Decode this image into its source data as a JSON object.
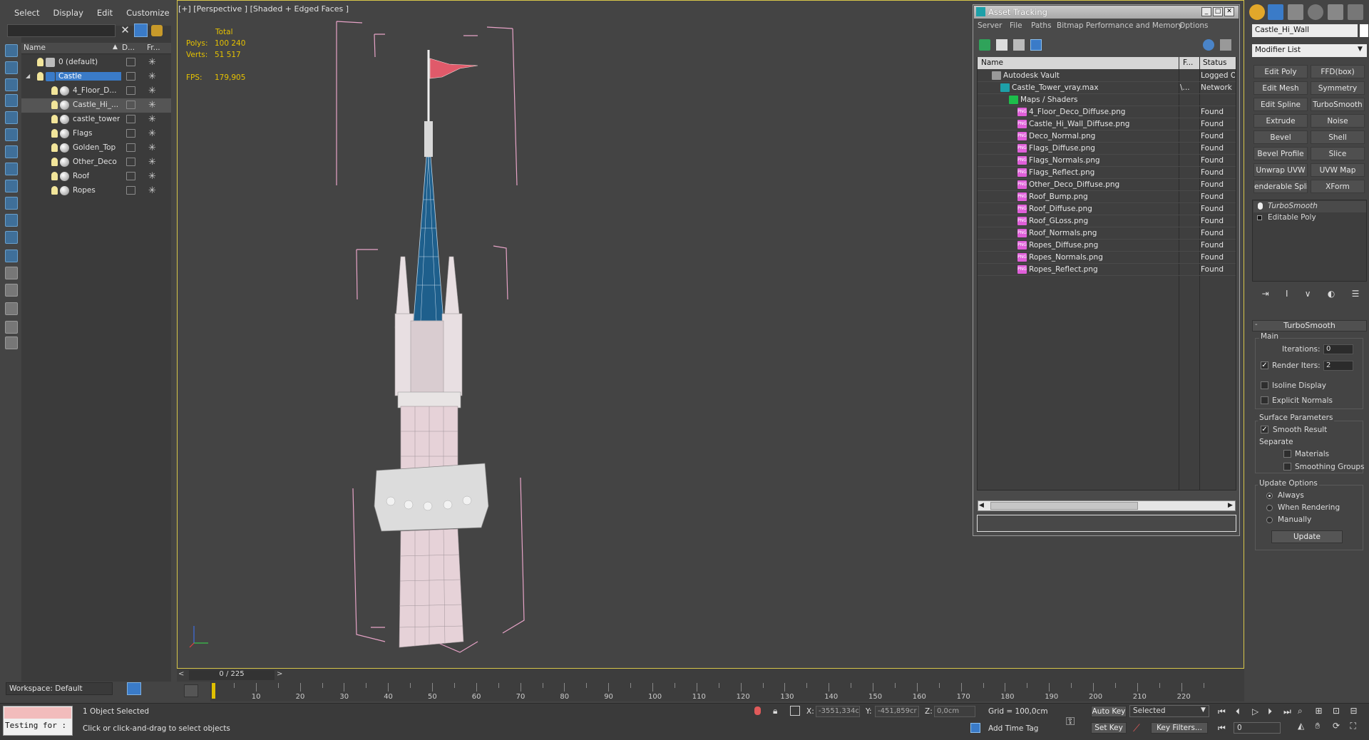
{
  "menu": [
    "Select",
    "Display",
    "Edit",
    "Customize"
  ],
  "scene": {
    "columns": [
      "Name",
      "D...",
      "Fr..."
    ],
    "rows": [
      {
        "name": "0 (default)",
        "indent": 0
      },
      {
        "name": "Castle",
        "indent": 0,
        "selected": true
      },
      {
        "name": "4_Floor_D...",
        "indent": 1
      },
      {
        "name": "Castle_Hi_...",
        "indent": 1
      },
      {
        "name": "castle_tower",
        "indent": 1
      },
      {
        "name": "Flags",
        "indent": 1
      },
      {
        "name": "Golden_Top",
        "indent": 1
      },
      {
        "name": "Other_Deco",
        "indent": 1
      },
      {
        "name": "Roof",
        "indent": 1
      },
      {
        "name": "Ropes",
        "indent": 1
      }
    ],
    "workspace": "Workspace: Default"
  },
  "viewport": {
    "label": "[+] [Perspective ] [Shaded + Edged Faces ]",
    "stats": {
      "total_label": "Total",
      "polys_label": "Polys:",
      "polys_value": "100 240",
      "verts_label": "Verts:",
      "verts_value": "51 517",
      "fps_label": "FPS:",
      "fps_value": "179,905"
    }
  },
  "asset_tracking": {
    "title": "Asset Tracking",
    "menu": [
      "Server",
      "File",
      "Paths",
      "Bitmap Performance and Memory",
      "Options"
    ],
    "columns": [
      "Name",
      "F...",
      "Status"
    ],
    "rows": [
      {
        "name": "Autodesk Vault",
        "f": "",
        "status": "Logged O",
        "type": "vault",
        "indent": 1
      },
      {
        "name": "Castle_Tower_vray.max",
        "f": "\\...",
        "status": "Network P",
        "type": "max",
        "indent": 2
      },
      {
        "name": "Maps / Shaders",
        "f": "",
        "status": "",
        "type": "maps",
        "indent": 3
      },
      {
        "name": "4_Floor_Deco_Diffuse.png",
        "f": "",
        "status": "Found",
        "type": "png",
        "indent": 4
      },
      {
        "name": "Castle_Hi_Wall_Diffuse.png",
        "f": "",
        "status": "Found",
        "type": "png",
        "indent": 4
      },
      {
        "name": "Deco_Normal.png",
        "f": "",
        "status": "Found",
        "type": "png",
        "indent": 4
      },
      {
        "name": "Flags_Diffuse.png",
        "f": "",
        "status": "Found",
        "type": "png",
        "indent": 4
      },
      {
        "name": "Flags_Normals.png",
        "f": "",
        "status": "Found",
        "type": "png",
        "indent": 4
      },
      {
        "name": "Flags_Reflect.png",
        "f": "",
        "status": "Found",
        "type": "png",
        "indent": 4
      },
      {
        "name": "Other_Deco_Diffuse.png",
        "f": "",
        "status": "Found",
        "type": "png",
        "indent": 4
      },
      {
        "name": "Roof_Bump.png",
        "f": "",
        "status": "Found",
        "type": "png",
        "indent": 4
      },
      {
        "name": "Roof_Diffuse.png",
        "f": "",
        "status": "Found",
        "type": "png",
        "indent": 4
      },
      {
        "name": "Roof_GLoss.png",
        "f": "",
        "status": "Found",
        "type": "png",
        "indent": 4
      },
      {
        "name": "Roof_Normals.png",
        "f": "",
        "status": "Found",
        "type": "png",
        "indent": 4
      },
      {
        "name": "Ropes_Diffuse.png",
        "f": "",
        "status": "Found",
        "type": "png",
        "indent": 4
      },
      {
        "name": "Ropes_Normals.png",
        "f": "",
        "status": "Found",
        "type": "png",
        "indent": 4
      },
      {
        "name": "Ropes_Reflect.png",
        "f": "",
        "status": "Found",
        "type": "png",
        "indent": 4
      }
    ]
  },
  "command_panel": {
    "object_name": "Castle_Hi_Wall",
    "modifier_list": "Modifier List",
    "modifier_buttons": [
      "Edit Poly",
      "FFD(box)",
      "Edit Mesh",
      "Symmetry",
      "Edit Spline",
      "TurboSmooth",
      "Extrude",
      "Noise",
      "Bevel",
      "Shell",
      "Bevel Profile",
      "Slice",
      "Unwrap UVW",
      "UVW Map",
      "enderable Splin",
      "XForm"
    ],
    "stack": [
      "TurboSmooth",
      "Editable Poly"
    ],
    "turbosmooth": {
      "title": "TurboSmooth",
      "main": "Main",
      "iterations_label": "Iterations:",
      "iterations": "0",
      "render_iters_label": "Render Iters:",
      "render_iters": "2",
      "isoline": "Isoline Display",
      "explicit_normals": "Explicit Normals",
      "surface_params": "Surface Parameters",
      "smooth_result": "Smooth Result",
      "separate": "Separate",
      "materials": "Materials",
      "smoothing_groups": "Smoothing Groups",
      "update_options": "Update Options",
      "always": "Always",
      "when_rendering": "When Rendering",
      "manually": "Manually",
      "update": "Update"
    }
  },
  "timeline": {
    "frame": "0 / 225",
    "ticks": [
      "10",
      "20",
      "30",
      "40",
      "50",
      "60",
      "70",
      "80",
      "90",
      "100",
      "110",
      "120",
      "130",
      "140",
      "150",
      "160",
      "170",
      "180",
      "190",
      "200",
      "210",
      "220"
    ]
  },
  "status": {
    "maxscript": "Testing for :",
    "selection": "1 Object Selected",
    "prompt": "Click or click-and-drag to select objects",
    "x_label": "X:",
    "x": "-3551,334c",
    "y_label": "Y:",
    "y": "-451,859cr",
    "z_label": "Z:",
    "z": "0,0cm",
    "grid": "Grid = 100,0cm",
    "add_time_tag": "Add Time Tag",
    "auto_key": "Auto Key",
    "selected": "Selected",
    "set_key": "Set Key",
    "key_filters": "Key Filters...",
    "frame_field": "0"
  }
}
